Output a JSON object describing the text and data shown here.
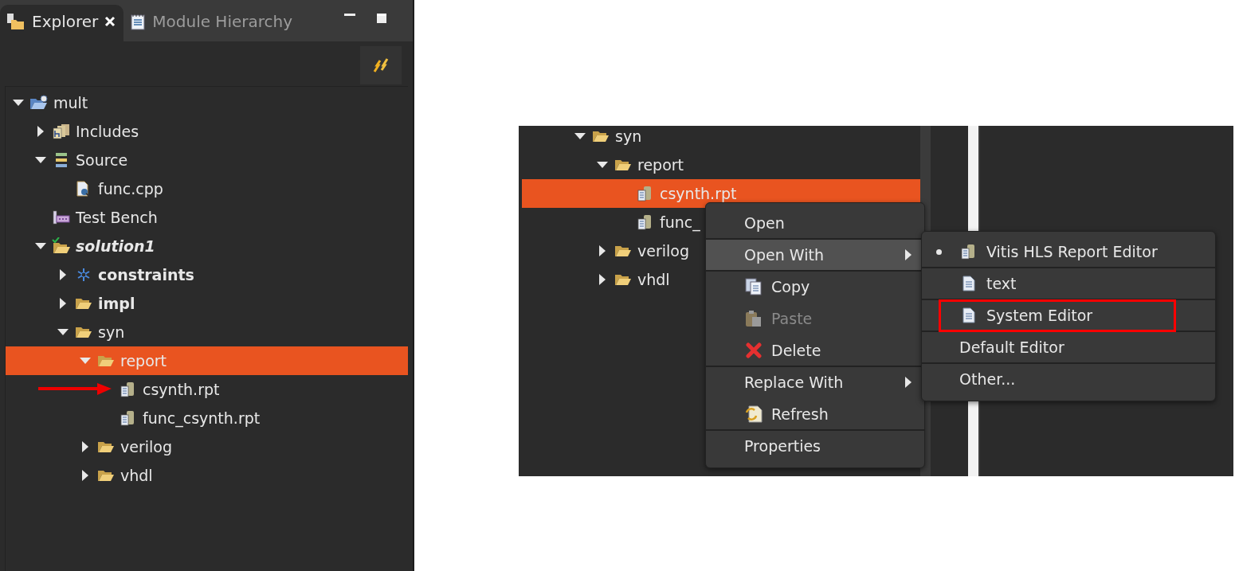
{
  "explorer": {
    "tabs": [
      {
        "label": "Explorer",
        "selected": true
      },
      {
        "label": "Module Hierarchy",
        "selected": false
      }
    ],
    "tree": [
      {
        "label": "mult",
        "kind": "project",
        "expanded": true,
        "selected": false,
        "children": [
          {
            "label": "Includes",
            "kind": "includes",
            "expanded": false,
            "selected": false
          },
          {
            "label": "Source",
            "kind": "source",
            "expanded": true,
            "selected": false,
            "children": [
              {
                "label": "func.cpp",
                "kind": "cpp",
                "selected": false
              }
            ]
          },
          {
            "label": "Test Bench",
            "kind": "testbench",
            "selected": false
          },
          {
            "label": "solution1",
            "kind": "solution",
            "expanded": true,
            "selected": false,
            "children": [
              {
                "label": "constraints",
                "kind": "constraints",
                "emphasized": true,
                "expanded": false,
                "selected": false
              },
              {
                "label": "impl",
                "kind": "folder",
                "emphasized": true,
                "expanded": false,
                "selected": false
              },
              {
                "label": "syn",
                "kind": "folder",
                "expanded": true,
                "selected": false,
                "children": [
                  {
                    "label": "report",
                    "kind": "folder",
                    "expanded": true,
                    "selected": true,
                    "children": [
                      {
                        "label": "csynth.rpt",
                        "kind": "report",
                        "selected": false,
                        "pointer": true
                      },
                      {
                        "label": "func_csynth.rpt",
                        "kind": "report",
                        "selected": false
                      }
                    ]
                  },
                  {
                    "label": "verilog",
                    "kind": "folder",
                    "expanded": false,
                    "selected": false
                  },
                  {
                    "label": "vhdl",
                    "kind": "folder",
                    "expanded": false,
                    "selected": false
                  }
                ]
              }
            ]
          }
        ]
      }
    ]
  },
  "detail": {
    "tree": [
      {
        "label": "syn",
        "kind": "folder",
        "expanded": true,
        "selected": false,
        "children": [
          {
            "label": "report",
            "kind": "folder",
            "expanded": true,
            "selected": false,
            "children": [
              {
                "label": "csynth.rpt",
                "kind": "report",
                "selected": true
              },
              {
                "label": "func_",
                "kind": "report",
                "selected": false
              }
            ]
          },
          {
            "label": "verilog",
            "kind": "folder",
            "expanded": false,
            "selected": false
          },
          {
            "label": "vhdl",
            "kind": "folder",
            "expanded": false,
            "selected": false
          }
        ]
      }
    ],
    "context_menu": [
      {
        "label": "Open",
        "highlighted": false,
        "disabled": false,
        "separator_after": true
      },
      {
        "label": "Open With",
        "highlighted": true,
        "disabled": false,
        "submenu": true,
        "separator_after": true
      },
      {
        "label": "Copy",
        "kind": "copy",
        "highlighted": false,
        "disabled": false
      },
      {
        "label": "Paste",
        "kind": "paste",
        "highlighted": false,
        "disabled": true
      },
      {
        "label": "Delete",
        "kind": "delete",
        "highlighted": false,
        "disabled": false,
        "separator_after": true
      },
      {
        "label": "Replace With",
        "highlighted": false,
        "disabled": false,
        "submenu": true
      },
      {
        "label": "Refresh",
        "kind": "refresh",
        "highlighted": false,
        "disabled": false,
        "separator_after": true
      },
      {
        "label": "Properties",
        "highlighted": false,
        "disabled": false
      }
    ],
    "submenu": [
      {
        "label": "Vitis HLS Report Editor",
        "kind": "report",
        "checked": true,
        "callout": false,
        "separator_after": true
      },
      {
        "label": "text",
        "kind": "doc",
        "checked": false,
        "callout": false,
        "separator_after": true
      },
      {
        "label": "System Editor",
        "kind": "doc",
        "checked": false,
        "callout": true,
        "separator_after": true
      },
      {
        "label": "Default Editor",
        "checked": false,
        "callout": false,
        "separator_after": true
      },
      {
        "label": "Other...",
        "checked": false,
        "callout": false
      }
    ]
  }
}
